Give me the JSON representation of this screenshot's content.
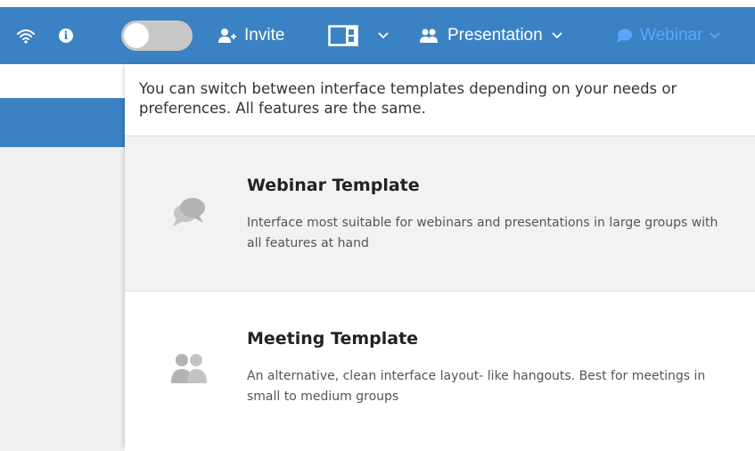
{
  "toolbar": {
    "wifi_icon": "wifi-icon",
    "info_icon": "info-icon",
    "info_glyph": "i",
    "toggle_state": "off",
    "invite_label": "Invite",
    "layout_icon": "layout-panel-icon",
    "presentation_label": "Presentation",
    "webinar_label": "Webinar",
    "colors": {
      "bar": "#3b82c4",
      "active": "#5aa6ff"
    }
  },
  "dropdown": {
    "description": "You can switch between interface templates depending on your needs or preferences. All features are the same.",
    "options": [
      {
        "icon": "chat-bubbles-icon",
        "title": "Webinar Template",
        "text": "Interface most suitable for webinars and presentations in large groups with all features at hand"
      },
      {
        "icon": "users-icon",
        "title": "Meeting Template",
        "text": "An alternative, clean interface layout- like hangouts. Best for meetings in small to medium groups"
      }
    ]
  }
}
